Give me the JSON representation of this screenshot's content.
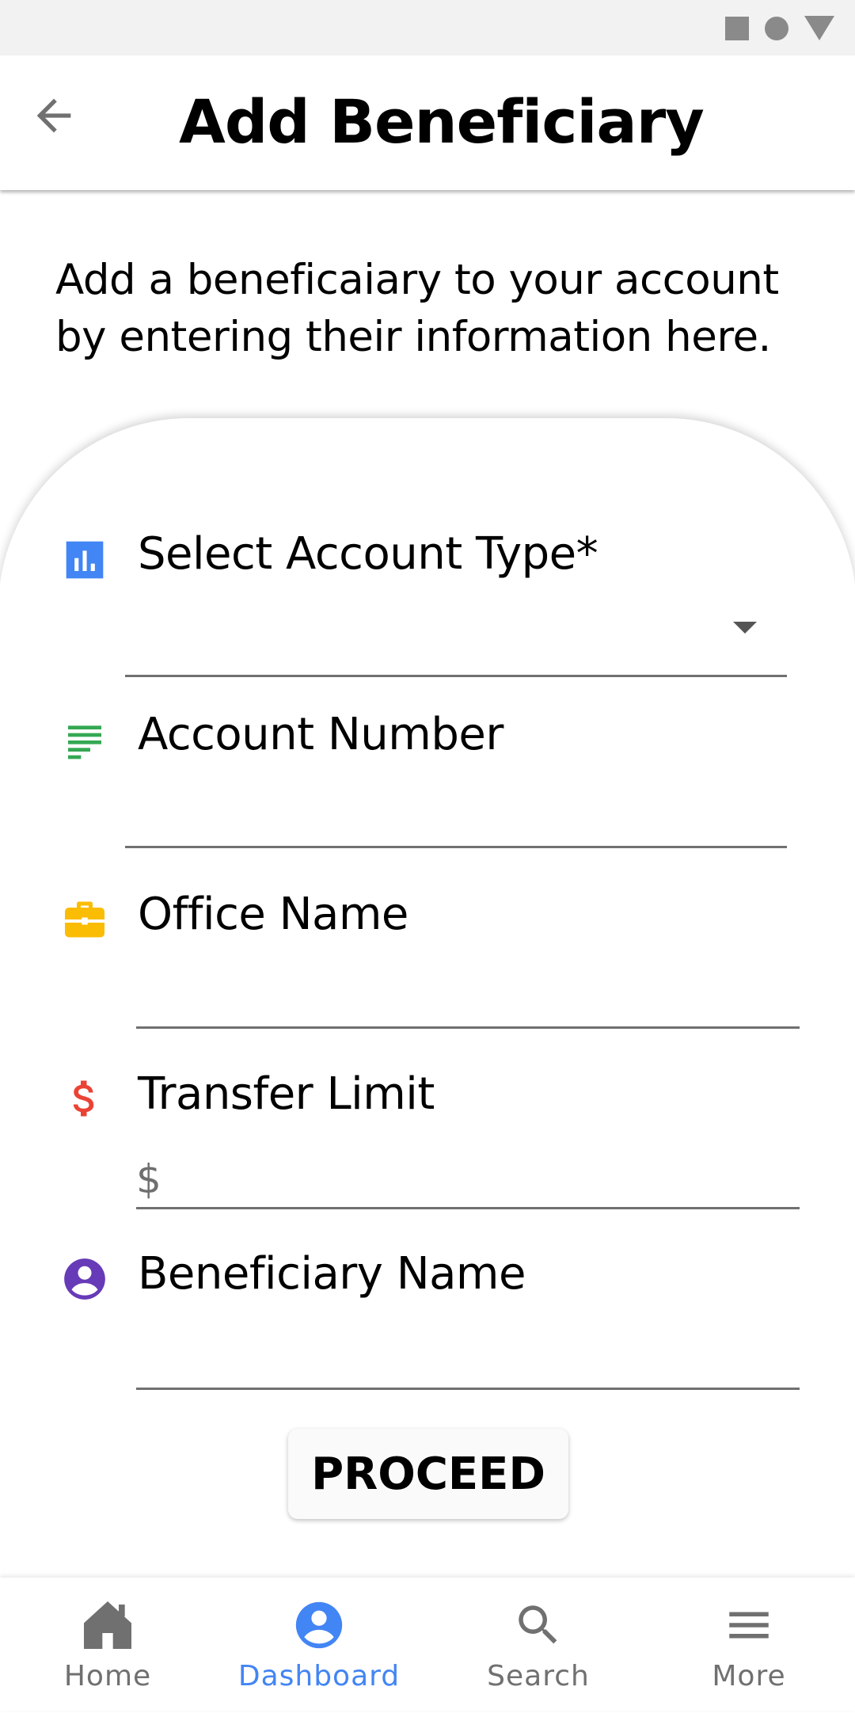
{
  "header": {
    "title": "Add Beneficiary",
    "back_icon": "arrow-back-icon"
  },
  "intro": {
    "text": "Add a beneficaiary to your account by entering their information here."
  },
  "form": {
    "fields": [
      {
        "label": "Select Account Type*",
        "icon": "bar-chart-icon",
        "icon_color": "#4285f4",
        "value": "",
        "type": "dropdown"
      },
      {
        "label": "Account Number",
        "icon": "notes-icon",
        "icon_color": "#34a853",
        "value": ""
      },
      {
        "label": "Office Name",
        "icon": "briefcase-icon",
        "icon_color": "#fbbc04",
        "value": ""
      },
      {
        "label": "Transfer Limit",
        "icon": "dollar-icon",
        "icon_color": "#ea4335",
        "prefix": "$",
        "value": ""
      },
      {
        "label": "Beneficiary Name",
        "icon": "account-circle-icon",
        "icon_color": "#673ab7",
        "value": ""
      }
    ],
    "proceed_label": "PROCEED"
  },
  "nav": {
    "items": [
      {
        "label": "Home",
        "icon": "home-icon",
        "active": false
      },
      {
        "label": "Dashboard",
        "icon": "account-circle-icon",
        "active": true
      },
      {
        "label": "Search",
        "icon": "search-icon",
        "active": false
      },
      {
        "label": "More",
        "icon": "menu-icon",
        "active": false
      }
    ],
    "active_color": "#4285f4",
    "inactive_color": "#707070"
  }
}
